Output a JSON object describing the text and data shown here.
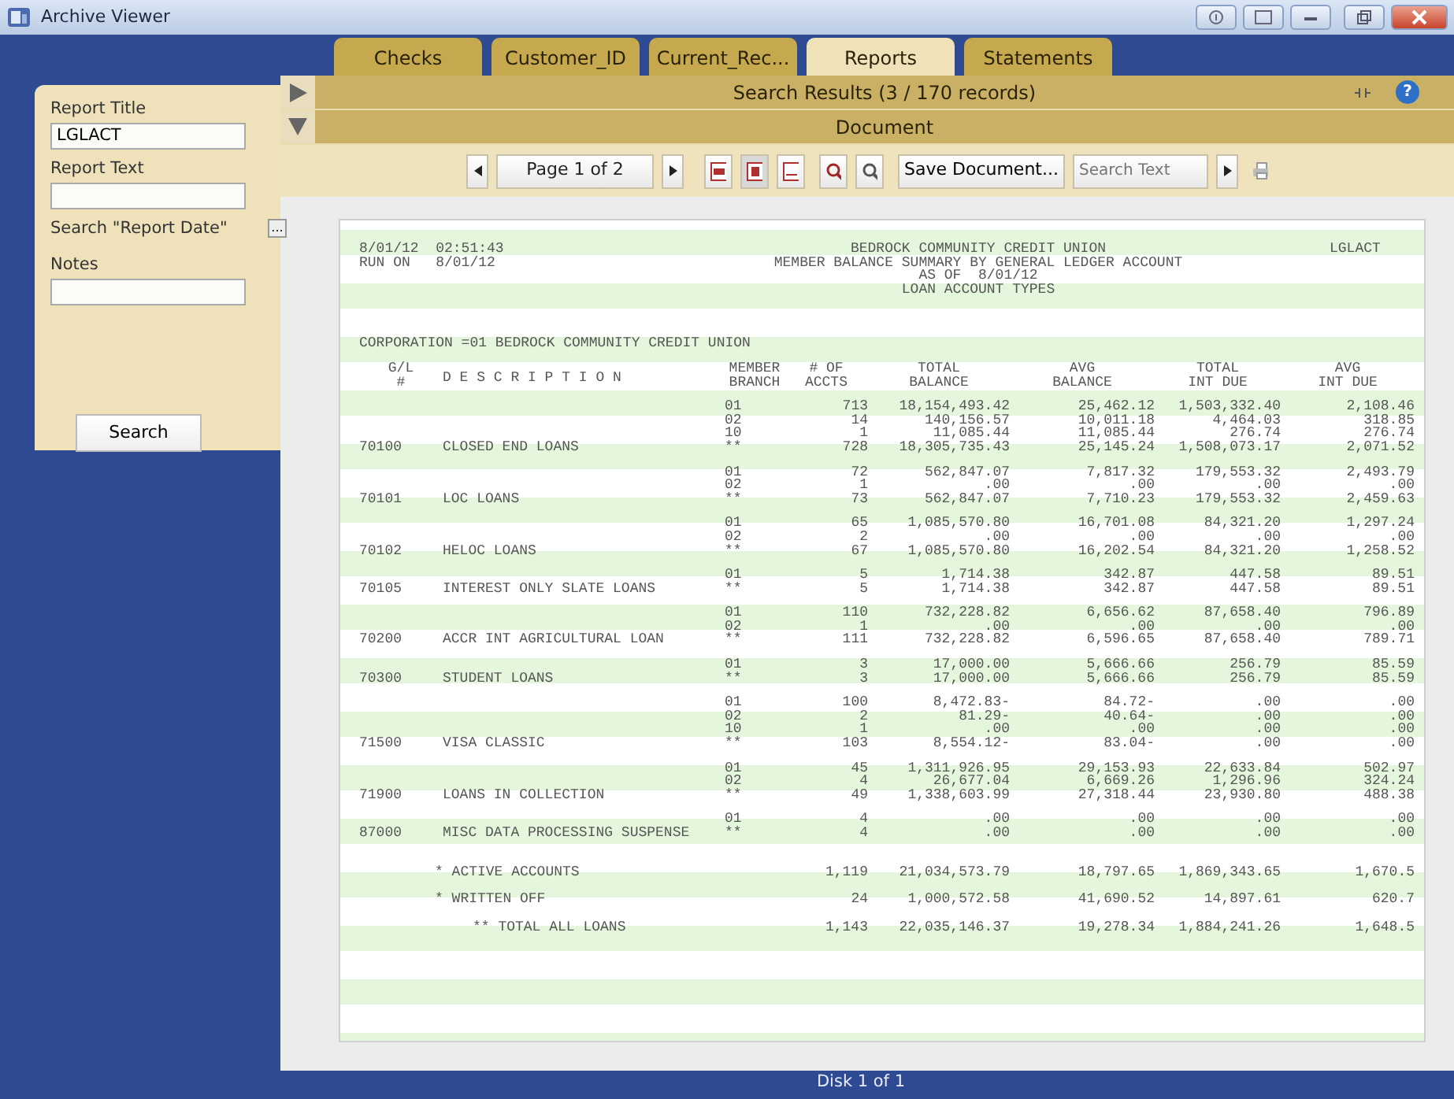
{
  "window": {
    "title": "Archive Viewer"
  },
  "tabs": [
    {
      "label": "Checks",
      "selected": false
    },
    {
      "label": "Customer_ID",
      "selected": false
    },
    {
      "label": "Current_Rec...",
      "selected": false
    },
    {
      "label": "Reports",
      "selected": true
    },
    {
      "label": "Statements",
      "selected": false
    }
  ],
  "search_panel": {
    "fields": [
      {
        "kind": "text",
        "label": "Report Title",
        "value": "LGLACT"
      },
      {
        "kind": "text",
        "label": "Report Text"
      },
      {
        "kind": "date",
        "label": "Search \"Report Date\"",
        "button": "..."
      },
      {
        "kind": "text",
        "label": "Notes"
      }
    ],
    "search_button": "Search"
  },
  "sections": [
    {
      "title": "Search Results (3 / 170 records)",
      "expanded": false
    },
    {
      "title": "Document",
      "expanded": true
    }
  ],
  "help_label": "?",
  "toolbar": {
    "page": "Page 1 of 2",
    "save_button": "Save Document...",
    "search_placeholder": "Search Text"
  },
  "report": {
    "header_left": [
      "8/01/12  02:51:43",
      "RUN ON   8/01/12"
    ],
    "header_center": [
      "BEDROCK COMMUNITY CREDIT UNION",
      "MEMBER BALANCE SUMMARY BY GENERAL LEDGER ACCOUNT",
      "AS OF  8/01/12",
      "LOAN ACCOUNT TYPES"
    ],
    "header_right": "LGLACT",
    "corporation": "CORPORATION =01 BEDROCK COMMUNITY CREDIT UNION",
    "columns": [
      [
        "G/L",
        "#"
      ],
      [
        "D E S C R I P T I O N"
      ],
      [
        "MEMBER",
        "BRANCH"
      ],
      [
        "# OF",
        "ACCTS"
      ],
      [
        "TOTAL",
        "BALANCE"
      ],
      [
        "AVG",
        "BALANCE"
      ],
      [
        "TOTAL",
        "INT DUE"
      ],
      [
        "AVG",
        "INT DUE"
      ]
    ],
    "groups": [
      {
        "gl": "70100",
        "description": "CLOSED END LOANS",
        "lines": [
          [
            "01",
            "713",
            "18,154,493.42",
            "25,462.12",
            "1,503,332.40",
            "2,108.46"
          ],
          [
            "02",
            "14",
            "140,156.57",
            "10,011.18",
            "4,464.03",
            "318.85"
          ],
          [
            "10",
            "1",
            "11,085.44",
            "11,085.44",
            "276.74",
            "276.74"
          ],
          [
            "**",
            "728",
            "18,305,735.43",
            "25,145.24",
            "1,508,073.17",
            "2,071.52"
          ]
        ]
      },
      {
        "gl": "70101",
        "description": "LOC LOANS",
        "lines": [
          [
            "01",
            "72",
            "562,847.07",
            "7,817.32",
            "179,553.32",
            "2,493.79"
          ],
          [
            "02",
            "1",
            ".00",
            ".00",
            ".00",
            ".00"
          ],
          [
            "**",
            "73",
            "562,847.07",
            "7,710.23",
            "179,553.32",
            "2,459.63"
          ]
        ]
      },
      {
        "gl": "70102",
        "description": "HELOC LOANS",
        "lines": [
          [
            "01",
            "65",
            "1,085,570.80",
            "16,701.08",
            "84,321.20",
            "1,297.24"
          ],
          [
            "02",
            "2",
            ".00",
            ".00",
            ".00",
            ".00"
          ],
          [
            "**",
            "67",
            "1,085,570.80",
            "16,202.54",
            "84,321.20",
            "1,258.52"
          ]
        ]
      },
      {
        "gl": "70105",
        "description": "INTEREST ONLY SLATE LOANS",
        "lines": [
          [
            "01",
            "5",
            "1,714.38",
            "342.87",
            "447.58",
            "89.51"
          ],
          [
            "**",
            "5",
            "1,714.38",
            "342.87",
            "447.58",
            "89.51"
          ]
        ]
      },
      {
        "gl": "70200",
        "description": "ACCR INT AGRICULTURAL LOAN",
        "lines": [
          [
            "01",
            "110",
            "732,228.82",
            "6,656.62",
            "87,658.40",
            "796.89"
          ],
          [
            "02",
            "1",
            ".00",
            ".00",
            ".00",
            ".00"
          ],
          [
            "**",
            "111",
            "732,228.82",
            "6,596.65",
            "87,658.40",
            "789.71"
          ]
        ]
      },
      {
        "gl": "70300",
        "description": "STUDENT LOANS",
        "lines": [
          [
            "01",
            "3",
            "17,000.00",
            "5,666.66",
            "256.79",
            "85.59"
          ],
          [
            "**",
            "3",
            "17,000.00",
            "5,666.66",
            "256.79",
            "85.59"
          ]
        ]
      },
      {
        "gl": "71500",
        "description": "VISA CLASSIC",
        "lines": [
          [
            "01",
            "100",
            "8,472.83-",
            "84.72-",
            ".00",
            ".00"
          ],
          [
            "02",
            "2",
            "81.29-",
            "40.64-",
            ".00",
            ".00"
          ],
          [
            "10",
            "1",
            ".00",
            ".00",
            ".00",
            ".00"
          ],
          [
            "**",
            "103",
            "8,554.12-",
            "83.04-",
            ".00",
            ".00"
          ]
        ]
      },
      {
        "gl": "71900",
        "description": "LOANS IN COLLECTION",
        "lines": [
          [
            "01",
            "45",
            "1,311,926.95",
            "29,153.93",
            "22,633.84",
            "502.97"
          ],
          [
            "02",
            "4",
            "26,677.04",
            "6,669.26",
            "1,296.96",
            "324.24"
          ],
          [
            "**",
            "49",
            "1,338,603.99",
            "27,318.44",
            "23,930.80",
            "488.38"
          ]
        ]
      },
      {
        "gl": "87000",
        "description": "MISC DATA PROCESSING SUSPENSE",
        "lines": [
          [
            "01",
            "4",
            ".00",
            ".00",
            ".00",
            ".00"
          ],
          [
            "**",
            "4",
            ".00",
            ".00",
            ".00",
            ".00"
          ]
        ]
      }
    ],
    "totals": [
      {
        "kind": "subtotal",
        "label": "* ACTIVE ACCOUNTS",
        "values": [
          "1,119",
          "21,034,573.79",
          "18,797.65",
          "1,869,343.65",
          "1,670.5"
        ]
      },
      {
        "kind": "subtotal",
        "label": "* WRITTEN OFF",
        "values": [
          "24",
          "1,000,572.58",
          "41,690.52",
          "14,897.61",
          "620.7"
        ]
      },
      {
        "kind": "grand",
        "label": "** TOTAL ALL LOANS",
        "values": [
          "1,143",
          "22,035,146.37",
          "19,278.34",
          "1,884,241.26",
          "1,648.5"
        ]
      }
    ]
  },
  "status_bar": "Disk 1 of 1"
}
